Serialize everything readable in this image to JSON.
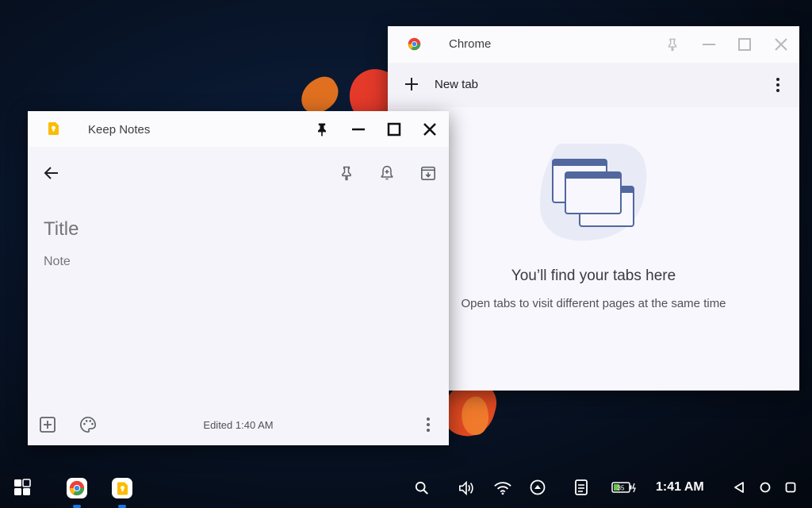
{
  "chrome_window": {
    "title": "Chrome",
    "new_tab_label": "New tab",
    "empty_heading": "You’ll find your tabs here",
    "empty_subtext": "Open tabs to visit different pages at the same time"
  },
  "keep_window": {
    "title": "Keep Notes",
    "title_placeholder": "Title",
    "note_placeholder": "Note",
    "edited_text": "Edited 1:40 AM"
  },
  "shelf": {
    "time": "1:41 AM",
    "battery_level": "35",
    "pinned_apps": [
      "chrome-icon",
      "keep-icon"
    ],
    "status_icons": [
      "search-icon",
      "volume-icon",
      "wifi-icon",
      "cast-icon",
      "notes-icon",
      "battery-icon"
    ],
    "nav_icons": [
      "back-icon",
      "home-icon",
      "overview-icon"
    ]
  },
  "colors": {
    "keep_yellow": "#fbbc04",
    "chrome_red": "#ea4335",
    "chrome_yellow": "#fbbc05",
    "chrome_green": "#34a853",
    "chrome_blue": "#4285f4",
    "illustration": "#51679e"
  }
}
